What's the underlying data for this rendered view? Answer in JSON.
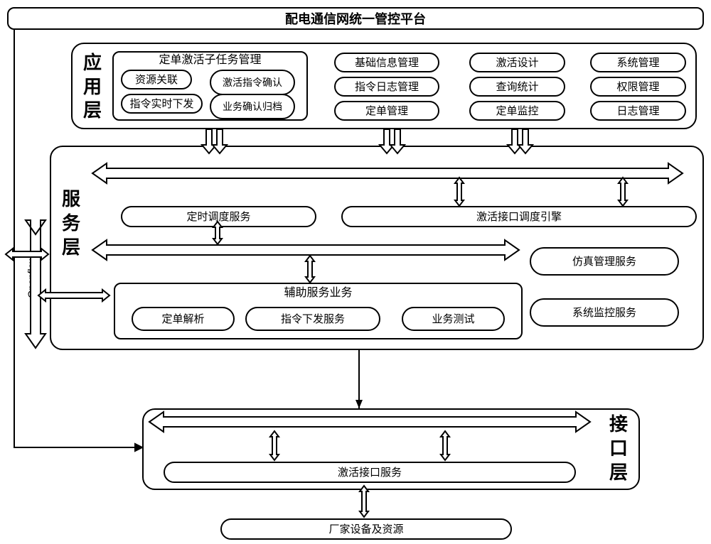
{
  "title": "配电通信网统一管控平台",
  "layers": {
    "app": {
      "label": "应用层",
      "subtask_group": "定单激活子任务管理",
      "subtasks": [
        "资源关联",
        "激活指令确认",
        "指令实时下发",
        "业务确认归档"
      ],
      "col2": [
        "基础信息管理",
        "指令日志管理",
        "定单管理"
      ],
      "col3": [
        "激活设计",
        "查询统计",
        "定单监控"
      ],
      "col4": [
        "系统管理",
        "权限管理",
        "日志管理"
      ]
    },
    "service": {
      "label": "服务层",
      "openflow": "Openflow",
      "items": {
        "timer": "定时调度服务",
        "engine": "激活接口调度引擎",
        "sim": "仿真管理服务",
        "aux_group": "辅助服务业务",
        "aux": [
          "定单解析",
          "指令下发服务",
          "业务测试"
        ],
        "monitor": "系统监控服务"
      }
    },
    "interface": {
      "label": "接口层",
      "item": "激活接口服务"
    },
    "vendor": "厂家设备及资源"
  }
}
